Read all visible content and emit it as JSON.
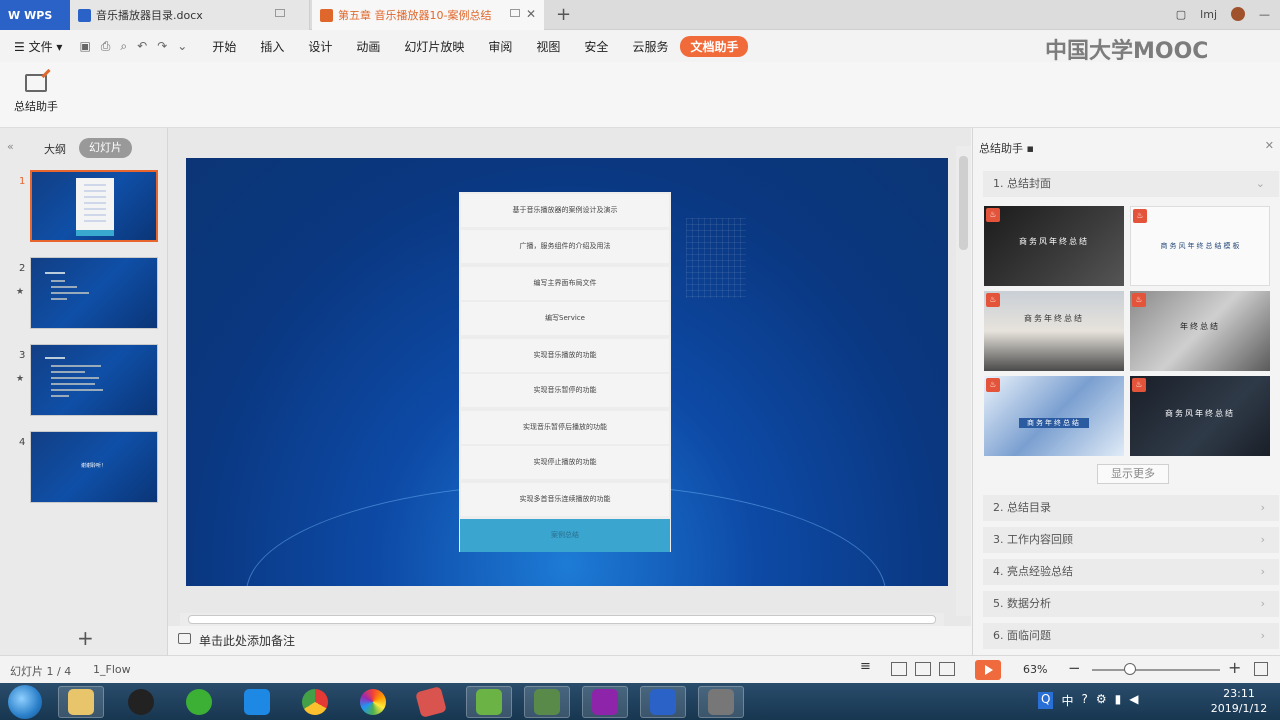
{
  "titlebar": {
    "wps_label": "WPS",
    "doc_tab": "音乐播放器目录.docx",
    "ppt_tab": "第五章 音乐播放器10-案例总结",
    "user": "lmj"
  },
  "menu": {
    "file": "文件",
    "items": [
      "开始",
      "插入",
      "设计",
      "动画",
      "幻灯片放映",
      "审阅",
      "视图",
      "安全",
      "云服务",
      "文档助手"
    ],
    "watermark": "中国大学MOOC"
  },
  "ribbon": {
    "assist_label": "总结助手"
  },
  "left_panel": {
    "outline_tab": "大纲",
    "slides_tab": "幻灯片",
    "slides": [
      {
        "num": "1",
        "text": ""
      },
      {
        "num": "2",
        "text": ""
      },
      {
        "num": "3",
        "text": ""
      },
      {
        "num": "4",
        "text": "谢谢聆听！"
      }
    ]
  },
  "slide": {
    "rows": [
      "基于音乐播放器的案例设计及演示",
      "广播，服务组件的介绍及用法",
      "编写主界面布局文件",
      "编写Service",
      "实现音乐播放的功能",
      "实现音乐暂停的功能",
      "实现音乐暂停后播放的功能",
      "实现停止播放的功能",
      "实现多首音乐连续播放的功能",
      "案例总结"
    ]
  },
  "notes": {
    "placeholder": "单击此处添加备注"
  },
  "right_panel": {
    "title": "总结助手",
    "section1": "1. 总结封面",
    "templates": [
      {
        "title": "商务风年终总结",
        "style": "dark"
      },
      {
        "title": "商务风年终总结模板",
        "style": "light"
      },
      {
        "title": "商务年终总结",
        "style": "city"
      },
      {
        "title": "年终总结",
        "style": "desk"
      },
      {
        "title": "商务年终总结",
        "style": "blue"
      },
      {
        "title": "商务风年终总结",
        "style": "night"
      }
    ],
    "more_button": "显示更多",
    "sections": [
      "2. 总结目录",
      "3. 工作内容回顾",
      "4. 亮点经验总结",
      "5. 数据分析",
      "6. 面临问题"
    ]
  },
  "status": {
    "slide_count": "幻灯片 1 / 4",
    "theme": "1_Flow",
    "zoom": "63%"
  },
  "taskbar": {
    "time": "23:11",
    "date": "2019/1/12",
    "ime": "中"
  },
  "colors": {
    "accent": "#f06a3a",
    "wps_blue": "#2b62c8",
    "slide_blue": "#0d4aa6",
    "row_highlight": "#3aa5cf"
  }
}
